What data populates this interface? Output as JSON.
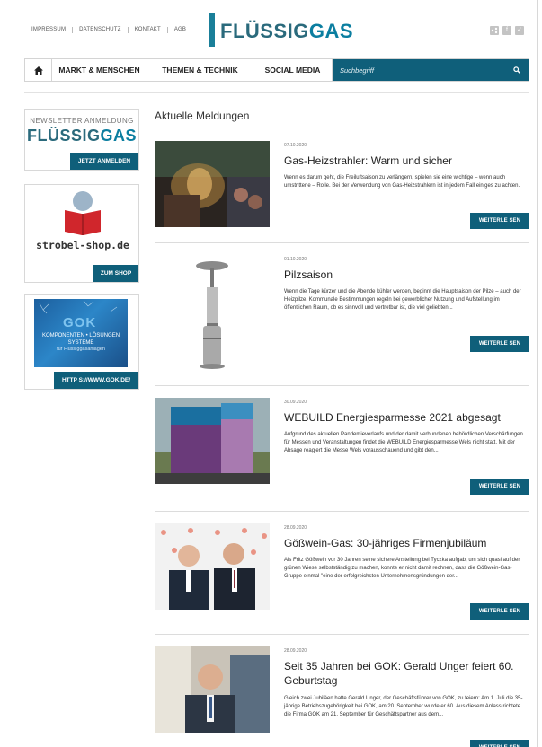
{
  "topnav": [
    "IMPRESSUM",
    "DATENSCHUTZ",
    "KONTAKT",
    "AGB"
  ],
  "logo": {
    "part1": "FLÜSSIG",
    "part2": "GAS"
  },
  "social": [
    "f",
    "✓"
  ],
  "mainnav": {
    "items": [
      "MARKT & MENSCHEN",
      "THEMEN & TECHNIK",
      "SOCIAL MEDIA"
    ],
    "search_placeholder": "Suchbegriff"
  },
  "sidebar": {
    "newsletter": {
      "title": "NEWSLETTER ANMELDUNG",
      "logo1": "FLÜSSIG",
      "logo2": "GAS",
      "button": "JETZT ANMELDEN"
    },
    "strobel": {
      "text": "strobel-shop.de",
      "button": "ZUM SHOP"
    },
    "gok": {
      "logo": "GOK",
      "line1": "KOMPONENTEN • LÖSUNGEN",
      "line2": "SYSTEME",
      "line3": "für Flüssiggasanlagen",
      "button": "HTTP S://WWW.GOK.DE/"
    }
  },
  "section_title": "Aktuelle Meldungen",
  "articles": [
    {
      "date": "07.10.2020",
      "title": "Gas-Heizstrahler: Warm und sicher",
      "text": "Wenn es darum geht, die Freiluftsaison zu verlängern, spielen sie eine wichtige – wenn auch umstrittene – Rolle. Bei der Verwendung von Gas-Heizstrahlern ist in jedem Fall einiges zu achten.",
      "more": "WEITERLE SEN"
    },
    {
      "date": "01.10.2020",
      "title": "Pilzsaison",
      "text": "Wenn die Tage kürzer und die Abende kühler werden, beginnt die Hauptsaison der Pilze – auch der Heizpilze. Kommunale Bestimmungen regeln bei gewerblicher Nutzung und Aufstellung im öffentlichen Raum, ob es sinnvoll und vertretbar ist, die viel geliebten...",
      "more": "WEITERLE SEN"
    },
    {
      "date": "30.09.2020",
      "title": "WEBUILD Energiesparmesse 2021 abgesagt",
      "text": "Aufgrund des aktuellen Pandemieverlaufs und der damit verbundenen behördlichen Verschärfungen für Messen und Veranstaltungen findet die WEBUILD Energiesparmesse Wels nicht statt. Mit der Absage reagiert die Messe Wels vorausschauend und gibt den...",
      "more": "WEITERLE SEN"
    },
    {
      "date": "28.09.2020",
      "title": "Gößwein-Gas: 30-jähriges Firmenjubiläum",
      "text": "Als Fritz Gößwein vor 30 Jahren seine sichere Anstellung bei Tyczka aufgab, um sich quasi auf der grünen Wiese selbstständig zu machen, konnte er nicht damit rechnen, dass die Gößwein-Gas-Gruppe einmal \"eine der erfolgreichsten Unternehmensgründungen der...",
      "more": "WEITERLE SEN"
    },
    {
      "date": "28.09.2020",
      "title": "Seit 35 Jahren bei GOK: Gerald Unger feiert 60. Geburtstag",
      "text": "Gleich zwei Jubiläen hatte Gerald Unger, der Geschäftsführer von GOK, zu feiern: Am 1. Juli die 35-jährige Betriebszugehörigkeit bei GOK, am 20. September wurde er 60. Aus diesem Anlass richtete die Firma GOK am 21. September für Geschäftspartner aus dem...",
      "more": "WEITERLE SEN"
    }
  ]
}
